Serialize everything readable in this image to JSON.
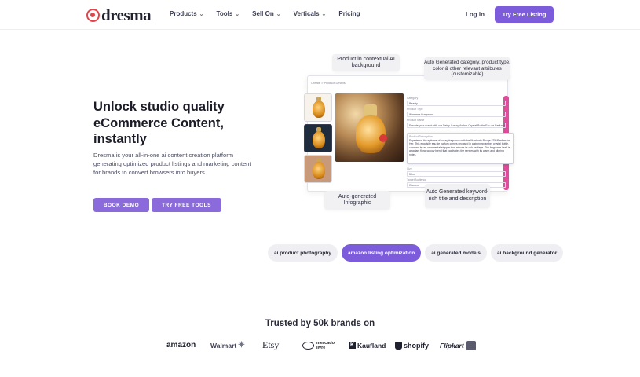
{
  "header": {
    "logo_text": "dresma",
    "nav": [
      {
        "label": "Products",
        "has_dropdown": true
      },
      {
        "label": "Tools",
        "has_dropdown": true
      },
      {
        "label": "Sell On",
        "has_dropdown": true
      },
      {
        "label": "Verticals",
        "has_dropdown": true
      },
      {
        "label": "Pricing",
        "has_dropdown": false
      }
    ],
    "login_label": "Log in",
    "cta_label": "Try Free Listing"
  },
  "hero": {
    "title": "Unlock studio quality eCommerce Content, instantly",
    "description": "Dresma is your all-in-one ai content creation platform generating optimized product listings and marketing content for brands to convert browsers into buyers",
    "book_demo_label": "BOOK DEMO",
    "try_tools_label": "TRY FREE TOOLS"
  },
  "mockup": {
    "breadcrumb": "Create > Product Details",
    "callouts": {
      "contextual_bg": "Product in contextual AI background",
      "category": "Auto Generated category, product type, color & other relevant attributes (customizable)",
      "infographic": "Auto-generated Infographic",
      "keyword_title": "Auto Generated keyword-rich title and description"
    },
    "fields": [
      {
        "label": "Category",
        "value": "Beauty"
      },
      {
        "label": "Product Type",
        "value": "Women's Fragrance"
      },
      {
        "label": "Product Name",
        "value": "Elevate your scent with our Daisy Luxury Amber Crystal Bottle Eau de Parfum Fragrance"
      }
    ],
    "description_label": "Product Description",
    "description_text": "Experience the epitome of luxury fragrance with the Illuminate Rouge EDP/Parfum for Her. This exquisite eau de parfum comes encased in a stunning amber crystal bottle, crowned by an ornamental stopper that mirrors its rich heritage. The fragrance itself is a radiant floral-woody blend that captivates the senses with its warm and alluring notes.",
    "size_label": "Size",
    "size_value": "50ml",
    "gender_label": "Target Audience",
    "gender_value": "Women"
  },
  "feature_pills": [
    {
      "label": "ai product photography",
      "active": false
    },
    {
      "label": "amazon listing optimization",
      "active": true
    },
    {
      "label": "ai generated models",
      "active": false
    },
    {
      "label": "ai background generator",
      "active": false
    }
  ],
  "trusted": {
    "heading": "Trusted by 50k brands on",
    "brands": [
      "amazon",
      "Walmart",
      "Etsy",
      "mercado livre",
      "Kaufland",
      "shopify",
      "Flipkart"
    ]
  },
  "colors": {
    "primary": "#7c5cdb",
    "accent_pink": "#e04b9b",
    "logo_red": "#e0474c"
  }
}
